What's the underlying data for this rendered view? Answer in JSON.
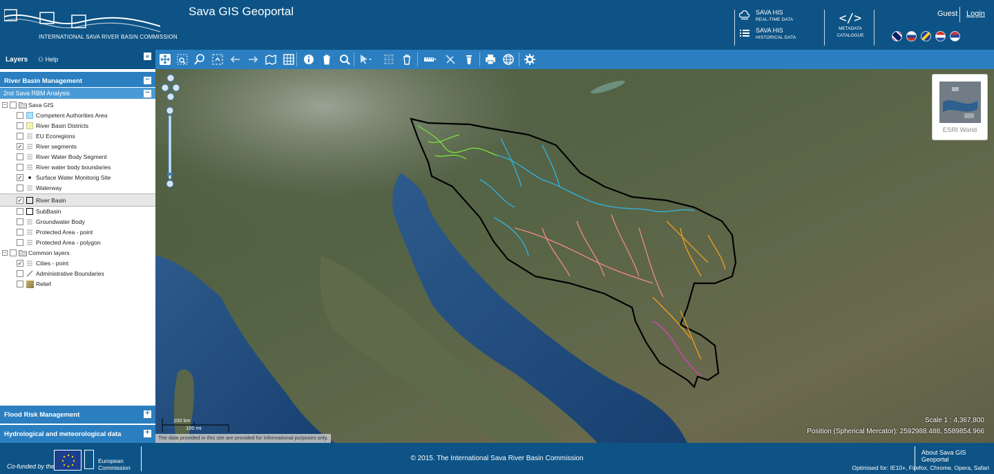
{
  "header": {
    "logo_text": "INTERNATIONAL SAVA RIVER BASIN COMMISSION",
    "title": "Sava GIS Geoportal",
    "his_realtime": {
      "title": "SAVA HIS",
      "subtitle": "REAL-TIME DATA"
    },
    "his_historical": {
      "title": "SAVA HIS",
      "subtitle": "HISTORICAL DATA"
    },
    "metadata": {
      "line1": "METADATA",
      "line2": "CATALOGUE"
    },
    "guest": "Guest",
    "login": "Login",
    "languages": [
      "english-flag",
      "slovenian-flag",
      "bosnian-flag",
      "croatian-flag",
      "serbian-flag"
    ]
  },
  "left_panel": {
    "tab_layers": "Layers",
    "tab_help": "Help",
    "collapse": "«",
    "section_rbm": "River Basin Management",
    "subsection": "2nd Sava RBM Analysis",
    "tree": {
      "group1": "Sava GIS",
      "layers1": [
        {
          "label": "Competent Authorities Area",
          "checked": false,
          "symbol": "fill-lightblue"
        },
        {
          "label": "River Basin Districts",
          "checked": false,
          "symbol": "fill-lightyellow"
        },
        {
          "label": "EU Ecoregions",
          "checked": false,
          "symbol": "legend-lines"
        },
        {
          "label": "River segments",
          "checked": true,
          "symbol": "legend-lines"
        },
        {
          "label": "River Water Body Segment",
          "checked": false,
          "symbol": "legend-lines"
        },
        {
          "label": "River water body boundaries",
          "checked": false,
          "symbol": "legend-lines"
        },
        {
          "label": "Surface Water Monitorig Site",
          "checked": true,
          "symbol": "dot"
        },
        {
          "label": "Waterway",
          "checked": false,
          "symbol": "legend-lines"
        },
        {
          "label": "River Basin",
          "checked": true,
          "symbol": "outline-square",
          "selected": true
        },
        {
          "label": "SubBasin",
          "checked": false,
          "symbol": "outline-square"
        },
        {
          "label": "Groundwater Body",
          "checked": false,
          "symbol": "legend-lines"
        },
        {
          "label": "Protected Area - point",
          "checked": false,
          "symbol": "legend-lines"
        },
        {
          "label": "Protected Area - polygon",
          "checked": false,
          "symbol": "legend-lines"
        }
      ],
      "group2": "Common layers",
      "layers2": [
        {
          "label": "Cities - point",
          "checked": true,
          "symbol": "legend-lines"
        },
        {
          "label": "Administrative Boundaries",
          "checked": false,
          "symbol": "diagonal-line"
        },
        {
          "label": "Relief",
          "checked": false,
          "symbol": "relief-tile"
        }
      ]
    },
    "section_flood": "Flood Risk Management",
    "section_hydro": "Hydrological and meteorological data",
    "minus": "−",
    "plus": "+"
  },
  "toolbar": [
    "pan-tool",
    "zoom-box-tool",
    "zoom-in-tool",
    "full-extent-tool",
    "back-arrow",
    "forward-arrow",
    "map-layers-tool",
    "attribute-table-tool",
    "info-tool",
    "delete-tool",
    "search-tool",
    "select-tool",
    "select-grid-tool",
    "clear-selection-tool",
    "measure-tool",
    "clear-measure-tool",
    "clear-graphics-tool",
    "print-tool",
    "web-services-tool",
    "settings-tool"
  ],
  "map": {
    "basemap_label": "ESRI World",
    "scale_km": "100 km",
    "scale_mi": "100 mi",
    "disclaimer": "The data provided in this site are provided for informational purposes only.",
    "scale_text": "Scale 1 : 4,367,800",
    "position_text": "Position (Spherical Mercator):  2592988.488, 5589854.966"
  },
  "footer": {
    "cofunded": "Co-funded by the",
    "eu_line1": "European",
    "eu_line2": "Commission",
    "copyright": "© 2015. The International Sava River Basin Commission",
    "about": "About Sava GIS Geoportal",
    "optimised": "Optimised for: IE10+, Firefox, Chrome, Opera, Safari"
  },
  "colors": {
    "header_blue": "#0d5385",
    "section_blue": "#2b7fc0",
    "subsection_blue": "#4a9ad6",
    "river_green": "#7be33a",
    "river_cyan": "#2fb6e6",
    "river_pink": "#f08a8a",
    "river_orange": "#f0a21e",
    "river_magenta": "#e040c0"
  }
}
